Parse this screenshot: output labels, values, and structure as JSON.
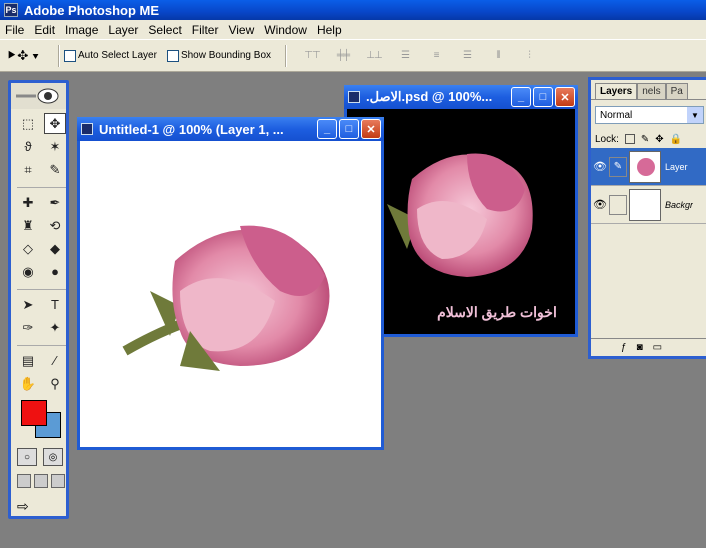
{
  "app": {
    "title": "Adobe Photoshop ME"
  },
  "menu": [
    "File",
    "Edit",
    "Image",
    "Layer",
    "Select",
    "Filter",
    "View",
    "Window",
    "Help"
  ],
  "options": {
    "auto_select_label": "Auto Select Layer",
    "bounding_box_label": "Show Bounding Box",
    "tool_indicator": "⯈✥ ▾"
  },
  "windows": {
    "untitled": {
      "title": "Untitled-1 @ 100% (Layer 1, ..."
    },
    "asl": {
      "title": ".الاصل.psd @ 100%...",
      "arabic_text": "اخوات طريق الاسلام"
    }
  },
  "layers_panel": {
    "tabs": [
      "Layers",
      "nels",
      "Pa"
    ],
    "blend_mode": "Normal",
    "lock_label": "Lock:",
    "layers": [
      {
        "name": "Layer",
        "selected": true
      },
      {
        "name": "Backgr",
        "selected": false
      }
    ]
  },
  "colors": {
    "foreground": "#ef1111",
    "background": "#5b9bd5",
    "titlebar": "#0846c8"
  }
}
